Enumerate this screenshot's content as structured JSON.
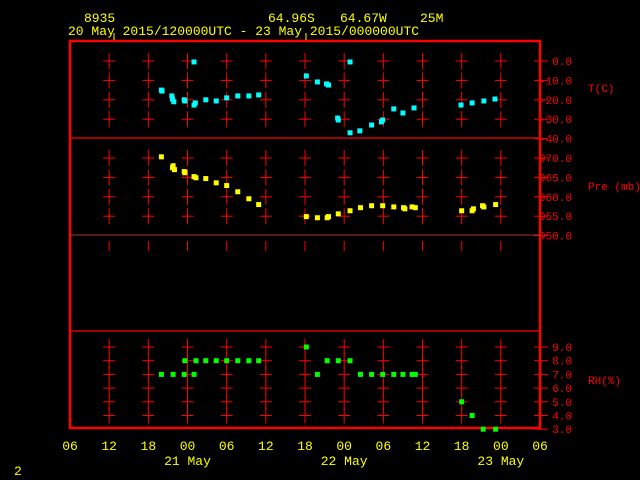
{
  "header": {
    "station": "8935",
    "lat": "64.96S",
    "lon": "64.67W",
    "elev": "25M",
    "period": "20 May 2015/120000UTC - 23 May 2015/000000UTC"
  },
  "page_number": "2",
  "colors": {
    "frame": "#ff0000",
    "text": "#ffff00",
    "temp": "#00ffff",
    "pressure": "#ffff00",
    "rh": "#00ff00"
  },
  "x_axis": {
    "unit": "hours since 20 May 06 UTC",
    "tick_hours": [
      0,
      6,
      12,
      18,
      24,
      30,
      36,
      42,
      48,
      54,
      60,
      66,
      72
    ],
    "tick_labels": [
      "06",
      "12",
      "18",
      "00",
      "06",
      "12",
      "18",
      "00",
      "06",
      "12",
      "18",
      "00",
      "06"
    ],
    "date_labels": [
      {
        "hour": 18,
        "label": "21 May"
      },
      {
        "hour": 42,
        "label": "22 May"
      },
      {
        "hour": 66,
        "label": "23 May"
      }
    ]
  },
  "chart_data": [
    {
      "type": "scatter",
      "title": "T(C)",
      "ylabel": "T(C)",
      "yticks": [
        0,
        -10,
        -20,
        -30,
        -40
      ],
      "ytick_labels": [
        "0.0",
        "-10.0",
        "-20.0",
        "-30.0",
        "-40.0"
      ],
      "ylim": [
        -40,
        10
      ],
      "x": [
        14,
        14.1,
        15.6,
        15.7,
        15.9,
        17.5,
        17.6,
        19,
        19.2,
        19,
        20.8,
        22.4,
        24,
        25.7,
        27.4,
        28.9,
        36.2,
        37.9,
        39.3,
        39.6,
        41,
        41.1,
        42.9,
        42.9,
        44.4,
        46.2,
        47.7,
        47.9,
        49.6,
        51,
        52.7,
        59.9,
        61.6,
        63.4,
        65.1
      ],
      "y": [
        -15,
        -15.5,
        -18,
        -19.6,
        -21,
        -20,
        -20.6,
        -22.7,
        -21.6,
        -0.5,
        -20,
        -20.6,
        -19,
        -18,
        -18,
        -17.5,
        -7.7,
        -10.8,
        -11.8,
        -12.4,
        -29.4,
        -30.4,
        -0.5,
        -37,
        -36,
        -33,
        -31.4,
        -30.4,
        -24.7,
        -26.8,
        -24.2,
        -22.7,
        -21.6,
        -20.6,
        -19.6
      ]
    },
    {
      "type": "scatter",
      "title": "Pre (mb)",
      "ylabel": "Pre (mb)",
      "yticks": [
        970,
        965,
        960,
        955,
        950
      ],
      "ytick_labels": [
        "970.0",
        "965.0",
        "960.0",
        "955.0",
        "950.0"
      ],
      "ylim": [
        950,
        975
      ],
      "x": [
        14,
        15.8,
        15.7,
        16,
        17.5,
        17.6,
        19,
        19.3,
        20.8,
        22.4,
        24,
        25.7,
        27.4,
        28.9,
        36.2,
        37.9,
        39.4,
        39.6,
        41.1,
        42.9,
        44.5,
        46.2,
        47.9,
        49.6,
        51.1,
        51.3,
        52.4,
        52.9,
        60,
        61.6,
        61.8,
        63.2,
        63.4,
        65.2
      ],
      "y": [
        970.3,
        968,
        967.5,
        967,
        966.5,
        966.2,
        965.2,
        964.9,
        964.7,
        963.6,
        962.9,
        961.3,
        959.5,
        958,
        954.9,
        954.6,
        954.6,
        954.9,
        955.6,
        956.4,
        957.2,
        957.7,
        957.7,
        957.4,
        957.2,
        956.9,
        957.4,
        957.2,
        956.4,
        956.4,
        956.9,
        957.7,
        957.4,
        958
      ]
    },
    {
      "type": "scatter",
      "title": "RH(%)",
      "ylabel": "RH(%)",
      "yticks": [
        9,
        8,
        7,
        6,
        5,
        4,
        3
      ],
      "ytick_labels": [
        "9.0",
        "8.0",
        "7.0",
        "6.0",
        "5.0",
        "4.0",
        "3.0"
      ],
      "ylim": [
        3,
        9
      ],
      "x": [
        14,
        15.8,
        17.5,
        19,
        17.6,
        19.3,
        20.8,
        22.4,
        24,
        25.7,
        27.4,
        28.9,
        36.2,
        37.9,
        39.4,
        41.1,
        42.9,
        44.5,
        46.2,
        47.9,
        49.6,
        51,
        52.4,
        52.9,
        60,
        61.6,
        63.3,
        65.2
      ],
      "y": [
        7,
        7,
        7,
        7,
        8,
        8,
        8,
        8,
        8,
        8,
        8,
        8,
        9,
        7,
        8,
        8,
        8,
        7,
        7,
        7,
        7,
        7,
        7,
        7,
        5,
        4,
        3,
        3
      ]
    }
  ]
}
